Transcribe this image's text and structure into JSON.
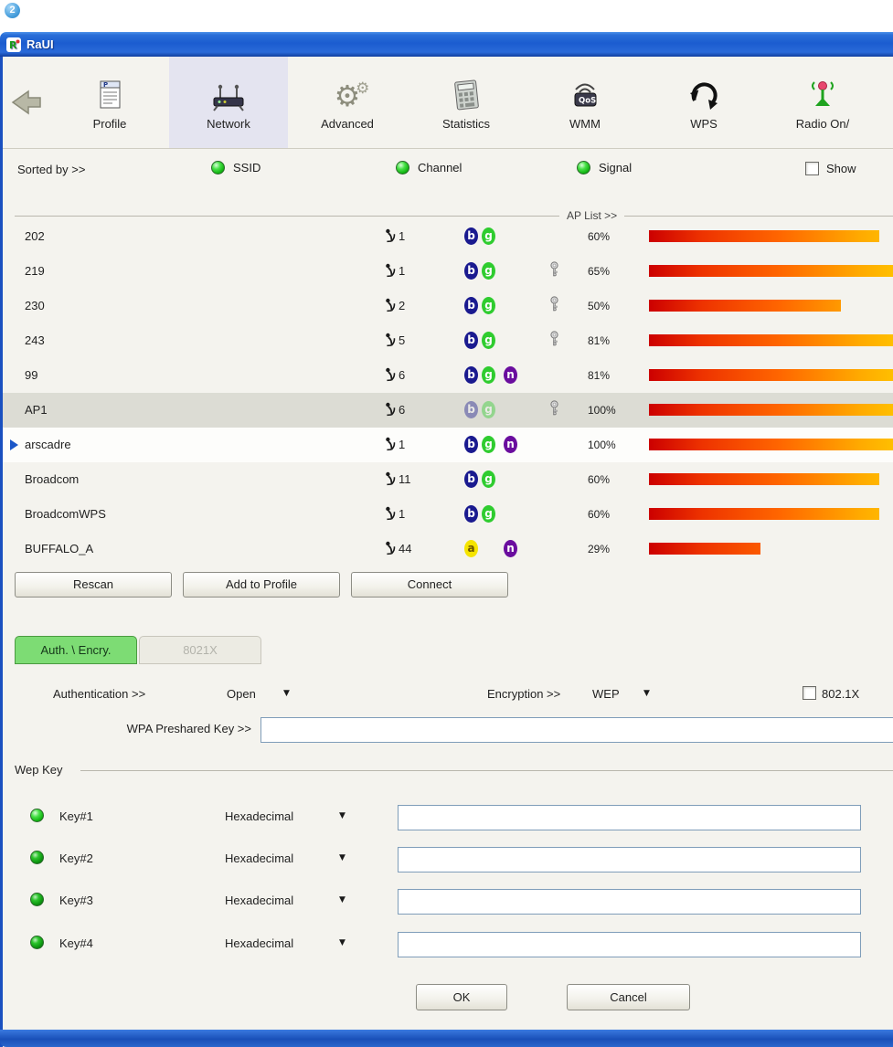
{
  "annotation": {
    "badge": "2"
  },
  "window": {
    "title": "RaUI"
  },
  "toolbar": {
    "items": [
      {
        "id": "profile",
        "label": "Profile"
      },
      {
        "id": "network",
        "label": "Network",
        "active": true
      },
      {
        "id": "advanced",
        "label": "Advanced"
      },
      {
        "id": "statistics",
        "label": "Statistics"
      },
      {
        "id": "wmm",
        "label": "WMM"
      },
      {
        "id": "wps",
        "label": "WPS"
      },
      {
        "id": "radio",
        "label": "Radio On/"
      }
    ]
  },
  "sort_bar": {
    "label": "Sorted by >>",
    "options": [
      {
        "label": "SSID"
      },
      {
        "label": "Channel"
      },
      {
        "label": "Signal"
      }
    ],
    "show_checkbox_label": "Show"
  },
  "ap_list": {
    "header": "AP List >>",
    "rows": [
      {
        "ssid": "202",
        "channel": "1",
        "bands": [
          "b",
          "g"
        ],
        "locked": false,
        "signal": "60%",
        "signal_value": 60
      },
      {
        "ssid": "219",
        "channel": "1",
        "bands": [
          "b",
          "g"
        ],
        "locked": true,
        "signal": "65%",
        "signal_value": 65
      },
      {
        "ssid": "230",
        "channel": "2",
        "bands": [
          "b",
          "g"
        ],
        "locked": true,
        "signal": "50%",
        "signal_value": 50
      },
      {
        "ssid": "243",
        "channel": "5",
        "bands": [
          "b",
          "g"
        ],
        "locked": true,
        "signal": "81%",
        "signal_value": 81
      },
      {
        "ssid": "99",
        "channel": "6",
        "bands": [
          "b",
          "g",
          "n"
        ],
        "locked": false,
        "signal": "81%",
        "signal_value": 81
      },
      {
        "ssid": "AP1",
        "channel": "6",
        "bands": [
          "b",
          "g"
        ],
        "locked": true,
        "signal": "100%",
        "signal_value": 100,
        "highlighted": true,
        "faded_bands": true
      },
      {
        "ssid": "arscadre",
        "channel": "1",
        "bands": [
          "b",
          "g",
          "n"
        ],
        "locked": false,
        "signal": "100%",
        "signal_value": 100,
        "selected": true
      },
      {
        "ssid": "Broadcom",
        "channel": "11",
        "bands": [
          "b",
          "g"
        ],
        "locked": false,
        "signal": "60%",
        "signal_value": 60
      },
      {
        "ssid": "BroadcomWPS",
        "channel": "1",
        "bands": [
          "b",
          "g"
        ],
        "locked": false,
        "signal": "60%",
        "signal_value": 60
      },
      {
        "ssid": "BUFFALO_A",
        "channel": "44",
        "bands": [
          "a",
          "n"
        ],
        "locked": false,
        "signal": "29%",
        "signal_value": 29
      }
    ]
  },
  "list_buttons": {
    "rescan": "Rescan",
    "add_to_profile": "Add to Profile",
    "connect": "Connect"
  },
  "tabs": {
    "auth_encry": "Auth. \\ Encry.",
    "x8021": "8021X"
  },
  "security": {
    "authentication_label": "Authentication >>",
    "authentication_value": "Open",
    "encryption_label": "Encryption >>",
    "encryption_value": "WEP",
    "dot1x_label": "802.1X",
    "wpa_key_label": "WPA Preshared Key >>",
    "wpa_key_value": ""
  },
  "wep": {
    "group_label": "Wep Key",
    "keys": [
      {
        "label": "Key#1",
        "format": "Hexadecimal",
        "value": ""
      },
      {
        "label": "Key#2",
        "format": "Hexadecimal",
        "value": ""
      },
      {
        "label": "Key#3",
        "format": "Hexadecimal",
        "value": ""
      },
      {
        "label": "Key#4",
        "format": "Hexadecimal",
        "value": ""
      }
    ]
  },
  "footer": {
    "ok": "OK",
    "cancel": "Cancel"
  },
  "colors": {
    "titlebar": "#1b5cd0",
    "band_b": "#1a1a8f",
    "band_g": "#2fcc2f",
    "band_n": "#6a0d9e",
    "band_a": "#f5e400",
    "tab_active": "#7ddc74",
    "signal_bar_start": "#cc0000",
    "signal_bar_end": "#ffff44"
  }
}
